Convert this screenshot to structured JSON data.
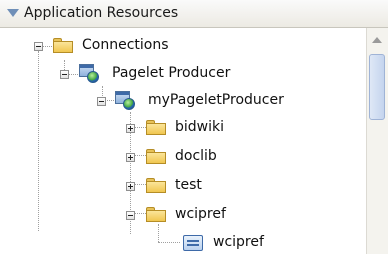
{
  "panel": {
    "title": "Application Resources"
  },
  "tree": {
    "connections": {
      "label": "Connections"
    },
    "pagelet_producer": {
      "label": "Pagelet Producer"
    },
    "my_pagelet_producer": {
      "label": "myPageletProducer"
    },
    "children": [
      {
        "label": "bidwiki"
      },
      {
        "label": "doclib"
      },
      {
        "label": "test"
      },
      {
        "label": "wcipref"
      }
    ],
    "leaf": {
      "label": "wcipref"
    }
  },
  "icons": {
    "header_toggle": "collapse-triangle-icon",
    "folder": "folder-icon",
    "producer": "pagelet-producer-icon",
    "portlet": "portlet-icon",
    "expand": "plus-expander-icon",
    "collapse": "minus-expander-icon"
  },
  "colors": {
    "folder": "#f0c650",
    "accent_blue": "#3e6aa8",
    "header_bg": "#eceae3"
  }
}
